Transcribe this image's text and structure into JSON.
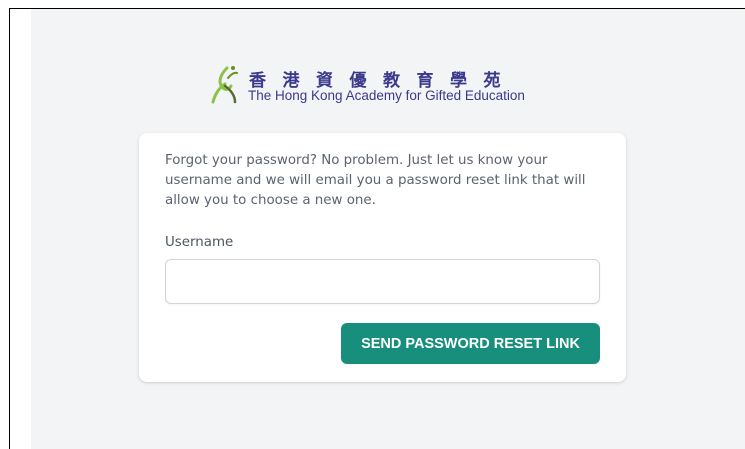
{
  "logo": {
    "chinese_name": "香港資優教育學苑",
    "english_name": "The Hong Kong Academy for Gifted Education",
    "colors": {
      "text": "#3b3a8c",
      "mark_green": "#8bc34a",
      "mark_dark": "#556b2f"
    }
  },
  "card": {
    "description": "Forgot your password? No problem. Just let us know your username and we will email you a password reset link that will allow you to choose a new one.",
    "username_label": "Username",
    "username_value": "",
    "username_placeholder": "",
    "submit_label": "SEND PASSWORD RESET LINK"
  },
  "colors": {
    "page_bg": "#f3f4f6",
    "card_bg": "#ffffff",
    "button_bg": "#178f7c",
    "button_text": "#ffffff"
  }
}
